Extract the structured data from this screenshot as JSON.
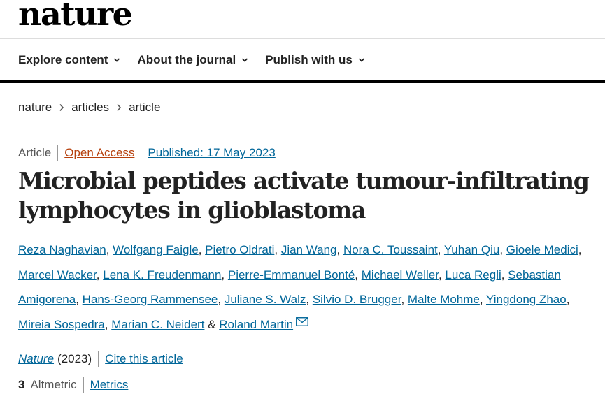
{
  "header": {
    "logo": "nature"
  },
  "nav": [
    {
      "label": "Explore content"
    },
    {
      "label": "About the journal"
    },
    {
      "label": "Publish with us"
    }
  ],
  "breadcrumb": {
    "items": [
      "nature",
      "articles",
      "article"
    ]
  },
  "meta": {
    "type": "Article",
    "access": "Open Access",
    "published": "Published: 17 May 2023"
  },
  "article": {
    "title": "Microbial peptides activate tumour-infiltrating lymphocytes in glioblastoma",
    "authors": [
      "Reza Naghavian",
      "Wolfgang Faigle",
      "Pietro Oldrati",
      "Jian Wang",
      "Nora C. Toussaint",
      "Yuhan Qiu",
      "Gioele Medici",
      "Marcel Wacker",
      "Lena K. Freudenmann",
      "Pierre-Emmanuel Bonté",
      "Michael Weller",
      "Luca Regli",
      "Sebastian Amigorena",
      "Hans-Georg Rammensee",
      "Juliane S. Walz",
      "Silvio D. Brugger",
      "Malte Mohme",
      "Yingdong Zhao",
      "Mireia Sospedra",
      "Marian C. Neidert",
      "Roland Martin"
    ],
    "author_sep": ", ",
    "author_last_sep": " & "
  },
  "citation": {
    "journal": "Nature",
    "year": "(2023)",
    "cite_label": "Cite this article"
  },
  "metrics": {
    "altmetric_score": "3",
    "altmetric_label": "Altmetric",
    "metrics_label": "Metrics"
  },
  "icons": {
    "nav_chevron": "chevron-down-icon",
    "breadcrumb_sep": "chevron-right-icon",
    "corresponding": "mail-icon"
  },
  "colors": {
    "link": "#006699",
    "open_access": "#b7410e",
    "text": "#222222"
  }
}
